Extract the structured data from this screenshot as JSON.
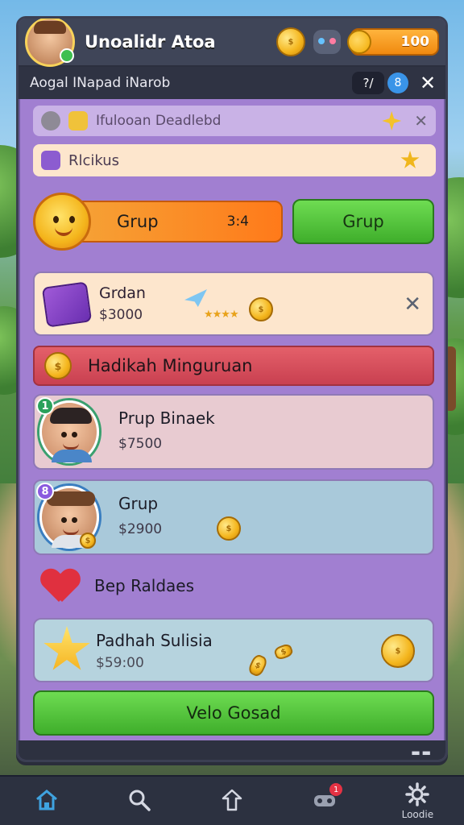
{
  "header": {
    "title": "Unoalidr Atoa",
    "score": "100"
  },
  "subbar": {
    "text": "Aogal INapad iNarob",
    "chip": "?/",
    "badge": "8"
  },
  "notices": [
    {
      "text": "Ifulooan Deadlebd"
    },
    {
      "text": "Rlcikus"
    }
  ],
  "grup_row": {
    "orange_label": "Grup",
    "orange_value": "3:4",
    "green_label": "Grup"
  },
  "bundle": {
    "name": "Grdan",
    "price": "$3000",
    "stars": "★★★★"
  },
  "banner": {
    "text": "Hadikah Minguruan"
  },
  "players": [
    {
      "rank": "1",
      "name": "Prup Binaek",
      "price": "$7500"
    },
    {
      "rank": "8",
      "name": "Grup",
      "price": "$2900"
    }
  ],
  "section": {
    "title": "Bep Raldaes"
  },
  "star_card": {
    "name": "Padhah Sulisia",
    "price": "$59:00"
  },
  "cta": {
    "label": "Velo Gosad"
  },
  "tabbar": {
    "items": [
      {
        "icon": "home-icon",
        "label": ""
      },
      {
        "icon": "search-icon",
        "label": ""
      },
      {
        "icon": "upload-icon",
        "label": ""
      },
      {
        "icon": "gamepad-icon",
        "label": "",
        "badge": "1"
      },
      {
        "icon": "gear-icon",
        "label": "Loodie"
      }
    ]
  },
  "colors": {
    "panel": "#a17fd1",
    "header": "#3f4558",
    "green": "#4cc23a",
    "orange": "#ff8a22",
    "banner_red": "#d84a58",
    "active_tab": "#3fa3e0"
  }
}
